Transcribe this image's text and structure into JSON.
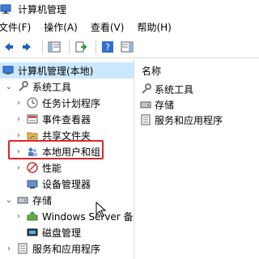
{
  "window": {
    "title": "计算机管理"
  },
  "menu": [
    "文件(F)",
    "操作(A)",
    "查看(V)",
    "帮助(H)"
  ],
  "toolbar": {
    "buttons": [
      "back-icon",
      "forward-icon",
      "show-hide-tree-icon",
      "properties-icon",
      "export-icon",
      "help-icon",
      "show-hide-action-pane-icon"
    ]
  },
  "tree": {
    "root": "计算机管理(本地)",
    "system_tools": "系统工具",
    "task_scheduler": "任务计划程序",
    "event_viewer": "事件查看器",
    "shared_folders": "共享文件夹",
    "local_users_groups": "本地用户和组",
    "performance": "性能",
    "device_manager": "设备管理器",
    "storage": "存储",
    "windows_server_backup": "Windows Server 备份",
    "disk_management": "磁盘管理",
    "services_apps": "服务和应用程序"
  },
  "list": {
    "header": "名称",
    "items": [
      "系统工具",
      "存储",
      "服务和应用程序"
    ]
  },
  "colors": {
    "selection": "#cce8ff",
    "highlight_border": "#e0262b"
  }
}
